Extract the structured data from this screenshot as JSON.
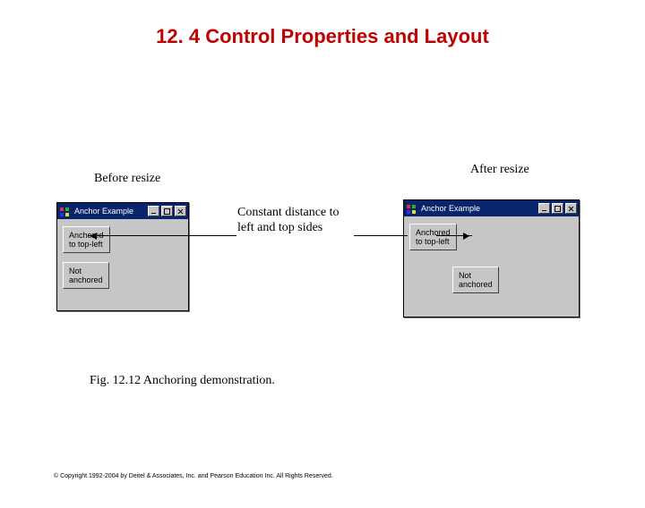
{
  "title": "12. 4  Control Properties and Layout",
  "labels": {
    "before": "Before resize",
    "after": "After resize"
  },
  "annotation": "Constant distance to left and top sides",
  "window_title": "Anchor Example",
  "buttons": {
    "anchored": "Anchored\nto top-left",
    "not": "Not\nanchored"
  },
  "figure_caption": "Fig. 12.12  Anchoring demonstration.",
  "copyright": "© Copyright 1992-2004 by Deitel & Associates, Inc. and Pearson Education Inc. All Rights Reserved."
}
